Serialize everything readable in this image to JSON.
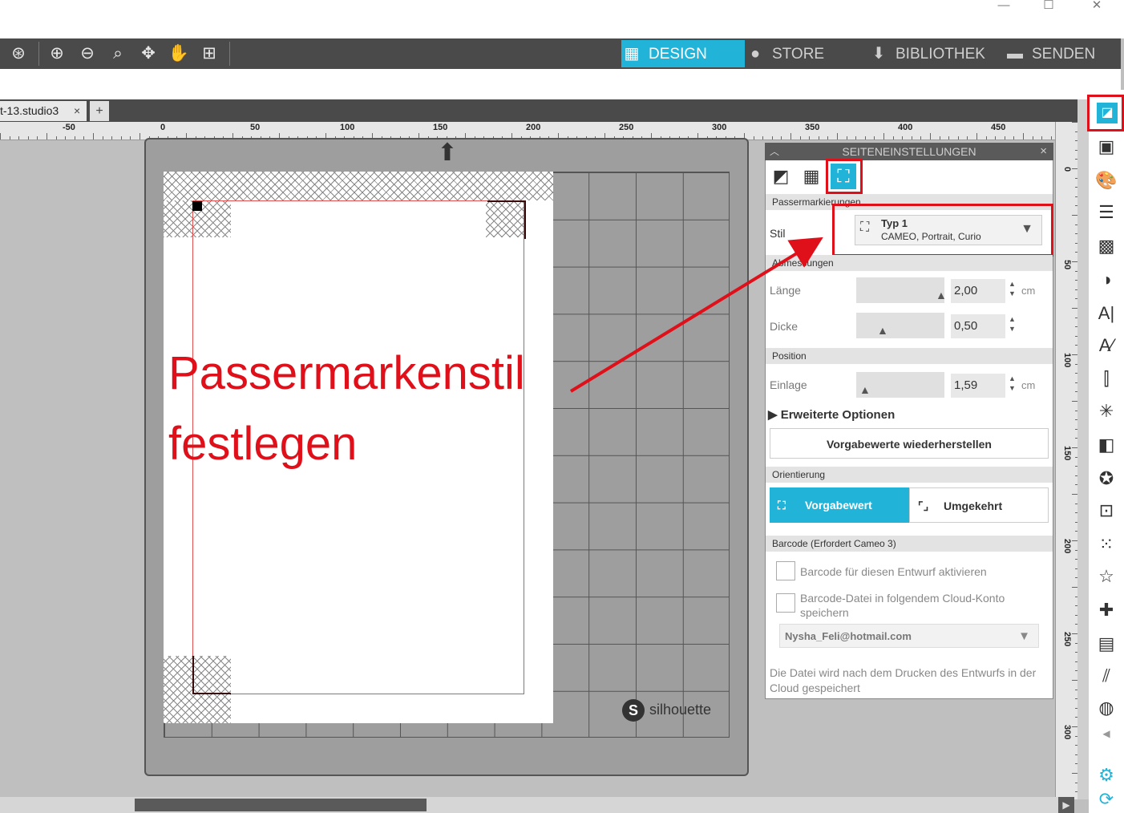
{
  "window": {
    "minimize_icon": "minimize-icon",
    "maximize_icon": "maximize-icon",
    "close_icon": "close-icon"
  },
  "toolbar": {
    "icons": [
      "select-icon",
      "zoom-in-icon",
      "zoom-out-icon",
      "zoom-selection-icon",
      "fit-icon",
      "pan-hand-icon",
      "fit-page-icon"
    ]
  },
  "nav": {
    "design": "DESIGN",
    "store": "STORE",
    "library": "BIBLIOTHEK",
    "send": "SENDEN"
  },
  "document_tab": {
    "name": "t-13.studio3",
    "close": "×",
    "add": "+"
  },
  "ruler": {
    "top_labels": [
      "-50",
      "0",
      "50",
      "100",
      "150",
      "200",
      "250",
      "300",
      "350",
      "400",
      "450"
    ],
    "right_labels": [
      "0",
      "50",
      "100",
      "150",
      "200",
      "250",
      "300"
    ]
  },
  "annotation": {
    "line1": "Passermarkenstil",
    "line2": "festlegen"
  },
  "brand": {
    "logo_text": "silhouette",
    "logo_letter": "S"
  },
  "panel": {
    "title": "SEITENEINSTELLUNGEN",
    "close": "×",
    "sections": {
      "registration": "Passermarkierungen",
      "dimensions": "Abmessungen",
      "position": "Position",
      "orientation": "Orientierung",
      "barcode": "Barcode (Erfordert Cameo 3)"
    },
    "style": {
      "label": "Stil",
      "value_title": "Typ 1",
      "value_sub": "CAMEO, Portrait, Curio"
    },
    "length": {
      "label": "Länge",
      "value": "2,00",
      "unit": "cm",
      "slider_level": 0.95
    },
    "thickness": {
      "label": "Dicke",
      "value": "0,50",
      "slider_level": 0.3
    },
    "inset": {
      "label": "Einlage",
      "value": "1,59",
      "unit": "cm",
      "slider_level": 0.1
    },
    "advanced": "Erweiterte Optionen",
    "restore_button": "Vorgabewerte wiederherstellen",
    "orientation": {
      "default": "Vorgabewert",
      "reverse": "Umgekehrt"
    },
    "barcode": {
      "enable": "Barcode für diesen Entwurf aktivieren",
      "save_cloud": "Barcode-Datei in folgendem Cloud-Konto speichern",
      "account": "Nysha_Feli@hotmail.com",
      "note": "Die Datei wird nach dem Drucken des Entwurfs in der Cloud gespeichert"
    }
  },
  "colors": {
    "accent": "#21b4d8",
    "annotation": "#e0101a",
    "toolbar": "#4a4a4a"
  }
}
